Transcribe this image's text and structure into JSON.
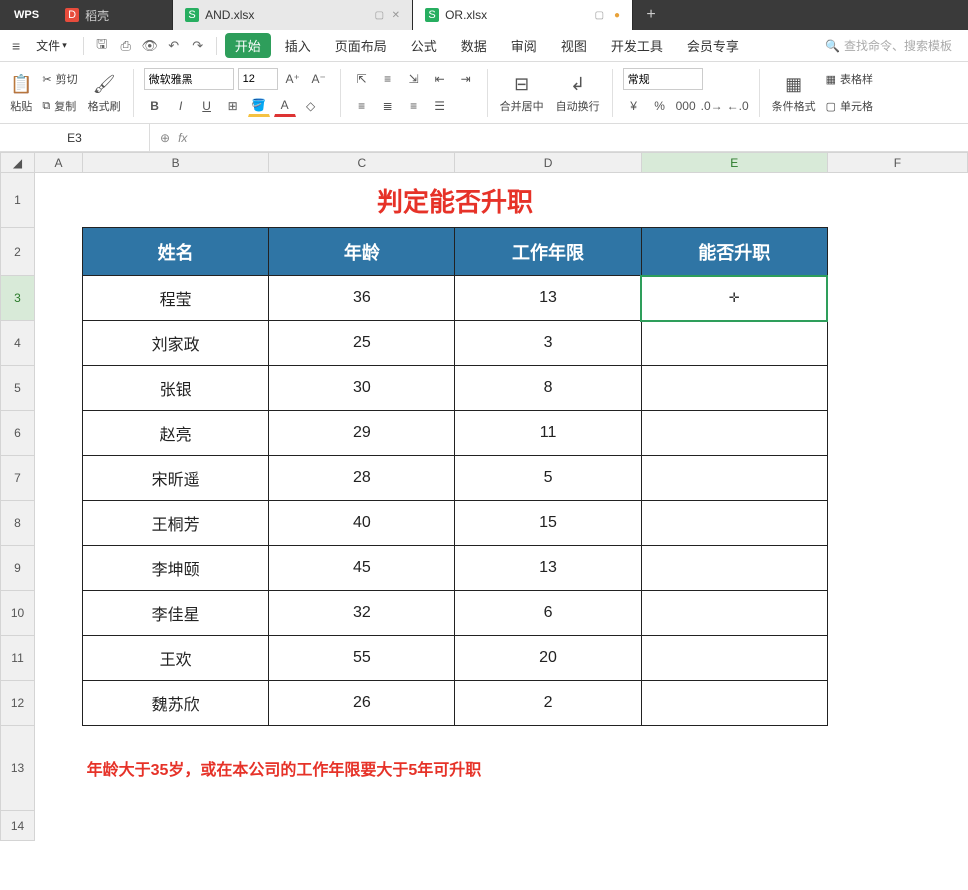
{
  "titlebar": {
    "app": "WPS",
    "tabs": [
      {
        "icon": "red",
        "iconText": "D",
        "label": "稻壳"
      },
      {
        "icon": "green",
        "iconText": "S",
        "label": "AND.xlsx"
      },
      {
        "icon": "green",
        "iconText": "S",
        "label": "OR.xlsx"
      }
    ],
    "plus": "+"
  },
  "menubar": {
    "file": "文件",
    "items": [
      "开始",
      "插入",
      "页面布局",
      "公式",
      "数据",
      "审阅",
      "视图",
      "开发工具",
      "会员专享"
    ],
    "searchPlaceholder": "查找命令、搜索模板"
  },
  "ribbon": {
    "paste": "粘贴",
    "cut": "剪切",
    "copy": "复制",
    "formatPainter": "格式刷",
    "fontName": "微软雅黑",
    "fontSize": "12",
    "mergeCenter": "合并居中",
    "wrap": "自动换行",
    "general": "常规",
    "condFormat": "条件格式",
    "tableFormat": "表格样",
    "cellFormat": "单元格"
  },
  "fbar": {
    "nameBox": "E3",
    "fx": "fx",
    "formula": ""
  },
  "sheet": {
    "cols": [
      "A",
      "B",
      "C",
      "D",
      "E",
      "F"
    ],
    "rows": [
      "1",
      "2",
      "3",
      "4",
      "5",
      "6",
      "7",
      "8",
      "9",
      "10",
      "11",
      "12",
      "13",
      "14"
    ],
    "title": "判定能否升职",
    "headers": [
      "姓名",
      "年龄",
      "工作年限",
      "能否升职"
    ],
    "data": [
      {
        "name": "程莹",
        "age": "36",
        "years": "13",
        "promo": ""
      },
      {
        "name": "刘家政",
        "age": "25",
        "years": "3",
        "promo": ""
      },
      {
        "name": "张银",
        "age": "30",
        "years": "8",
        "promo": ""
      },
      {
        "name": "赵亮",
        "age": "29",
        "years": "11",
        "promo": ""
      },
      {
        "name": "宋昕遥",
        "age": "28",
        "years": "5",
        "promo": ""
      },
      {
        "name": "王桐芳",
        "age": "40",
        "years": "15",
        "promo": ""
      },
      {
        "name": "李坤颐",
        "age": "45",
        "years": "13",
        "promo": ""
      },
      {
        "name": "李佳星",
        "age": "32",
        "years": "6",
        "promo": ""
      },
      {
        "name": "王欢",
        "age": "55",
        "years": "20",
        "promo": ""
      },
      {
        "name": "魏苏欣",
        "age": "26",
        "years": "2",
        "promo": ""
      }
    ],
    "note": "年龄大于35岁，或在本公司的工作年限要大于5年可升职"
  }
}
